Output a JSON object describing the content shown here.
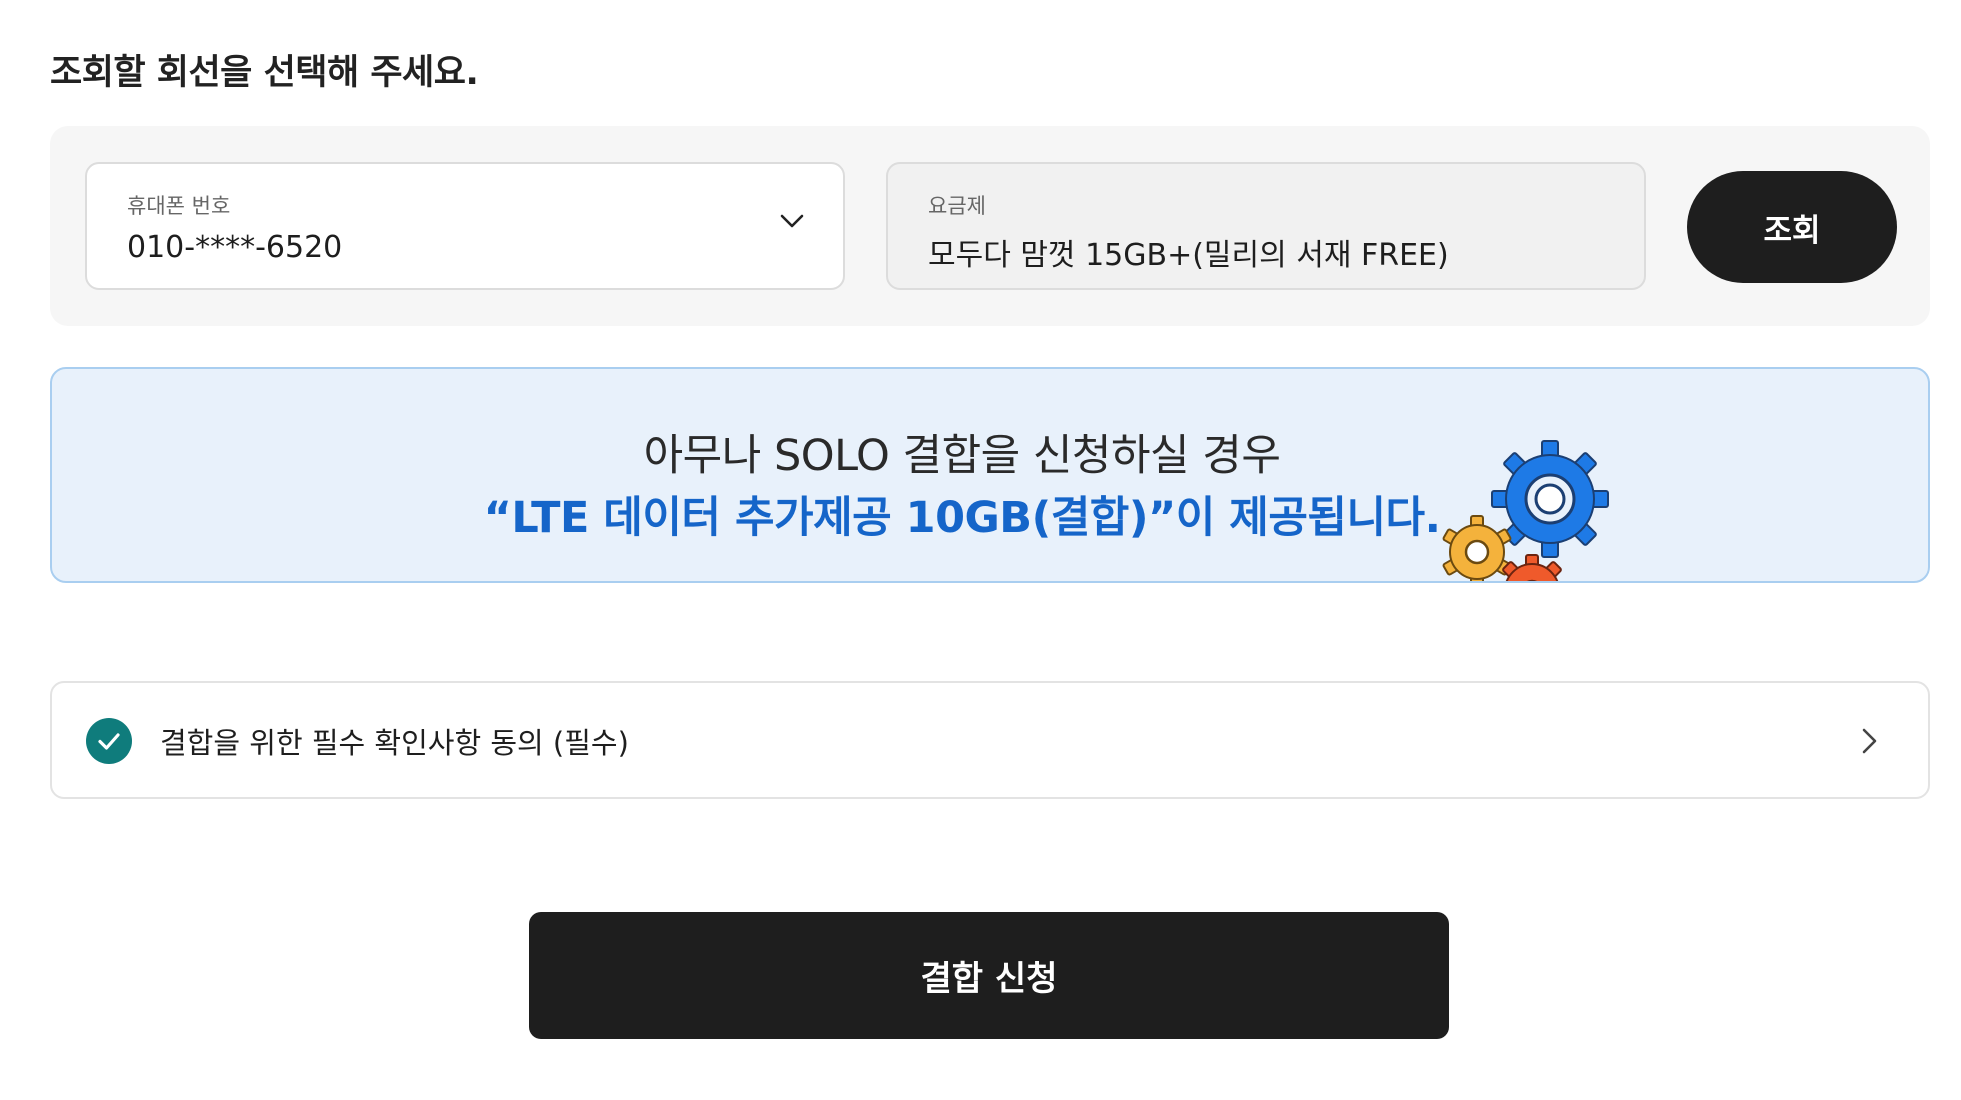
{
  "page_title": "조회할 회선을 선택해 주세요.",
  "phone_field": {
    "label": "휴대폰 번호",
    "value": "010-****-6520",
    "icon": "chevron-down-icon"
  },
  "plan_field": {
    "label": "요금제",
    "value": "모두다 맘껏 15GB+(밀리의 서재 FREE)"
  },
  "lookup_button": {
    "label": "조회"
  },
  "promo": {
    "line1": "아무나 SOLO 결합을 신청하실 경우",
    "line2": "“LTE 데이터 추가제공 10GB(결합)”이 제공됩니다.",
    "illustration": "gears-illustration",
    "highlight_color": "#1565c9"
  },
  "agreement": {
    "label": "결합을 위한 필수 확인사항 동의 (필수)",
    "checked": true,
    "check_color": "#0f7c7c",
    "icon": "chevron-right-icon"
  },
  "apply_button": {
    "label": "결합 신청"
  }
}
